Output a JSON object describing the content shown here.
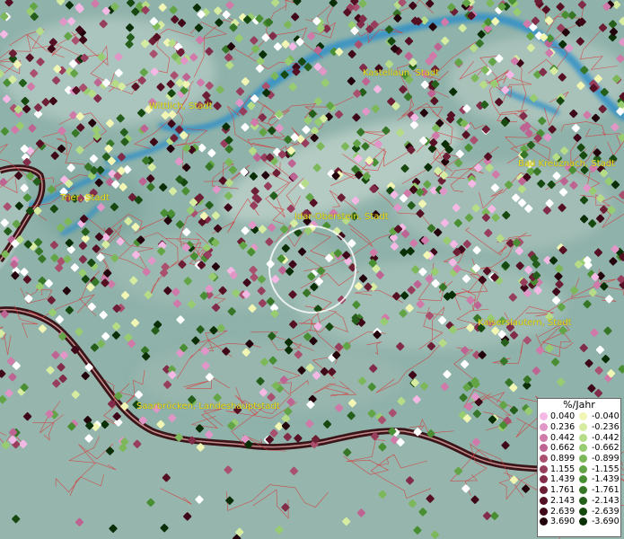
{
  "map": {
    "cities": [
      {
        "id": "kastellaun",
        "label": "Kastellaun, Stadt"
      },
      {
        "id": "wittlich",
        "label": "Wittlich, Stadt"
      },
      {
        "id": "bad-kreuznach",
        "label": "Bad Kreuznach, Stadt"
      },
      {
        "id": "trier",
        "label": "Trier, Stadt"
      },
      {
        "id": "idar-oberstein",
        "label": "Idar-Oberstein, Stadt"
      },
      {
        "id": "kaiserslautern",
        "label": "Kaiserslautern, Stadt"
      },
      {
        "id": "saarbruecken",
        "label": "Saarbrücken, Landeshauptstadt"
      }
    ]
  },
  "legend": {
    "title": "%/Jahr",
    "positive": [
      {
        "value": "0.040",
        "color": "#f4b8e4"
      },
      {
        "value": "0.236",
        "color": "#e196c8"
      },
      {
        "value": "0.442",
        "color": "#cf7aa8"
      },
      {
        "value": "0.662",
        "color": "#be6492"
      },
      {
        "value": "0.899",
        "color": "#a8506e"
      },
      {
        "value": "1.155",
        "color": "#963e5c"
      },
      {
        "value": "1.439",
        "color": "#812c48"
      },
      {
        "value": "1.761",
        "color": "#6c1e34"
      },
      {
        "value": "2.143",
        "color": "#561024"
      },
      {
        "value": "2.639",
        "color": "#3e0818"
      },
      {
        "value": "3.690",
        "color": "#24040c"
      }
    ],
    "negative": [
      {
        "value": "-0.040",
        "color": "#f2f6b4"
      },
      {
        "value": "-0.236",
        "color": "#d6eca0"
      },
      {
        "value": "-0.442",
        "color": "#b6dc88"
      },
      {
        "value": "-0.662",
        "color": "#98cc70"
      },
      {
        "value": "-0.899",
        "color": "#7cb85a"
      },
      {
        "value": "-1.155",
        "color": "#62a446"
      },
      {
        "value": "-1.439",
        "color": "#4a8e34"
      },
      {
        "value": "-1.761",
        "color": "#367626"
      },
      {
        "value": "-2.143",
        "color": "#245e1a"
      },
      {
        "value": "-2.639",
        "color": "#164810"
      },
      {
        "value": "-3.690",
        "color": "#0a2e06"
      }
    ]
  },
  "colors": {
    "boundary": "#d63a3a",
    "border": "#3a1418",
    "water": "#2d8fc7",
    "label": "#f2e21c"
  }
}
